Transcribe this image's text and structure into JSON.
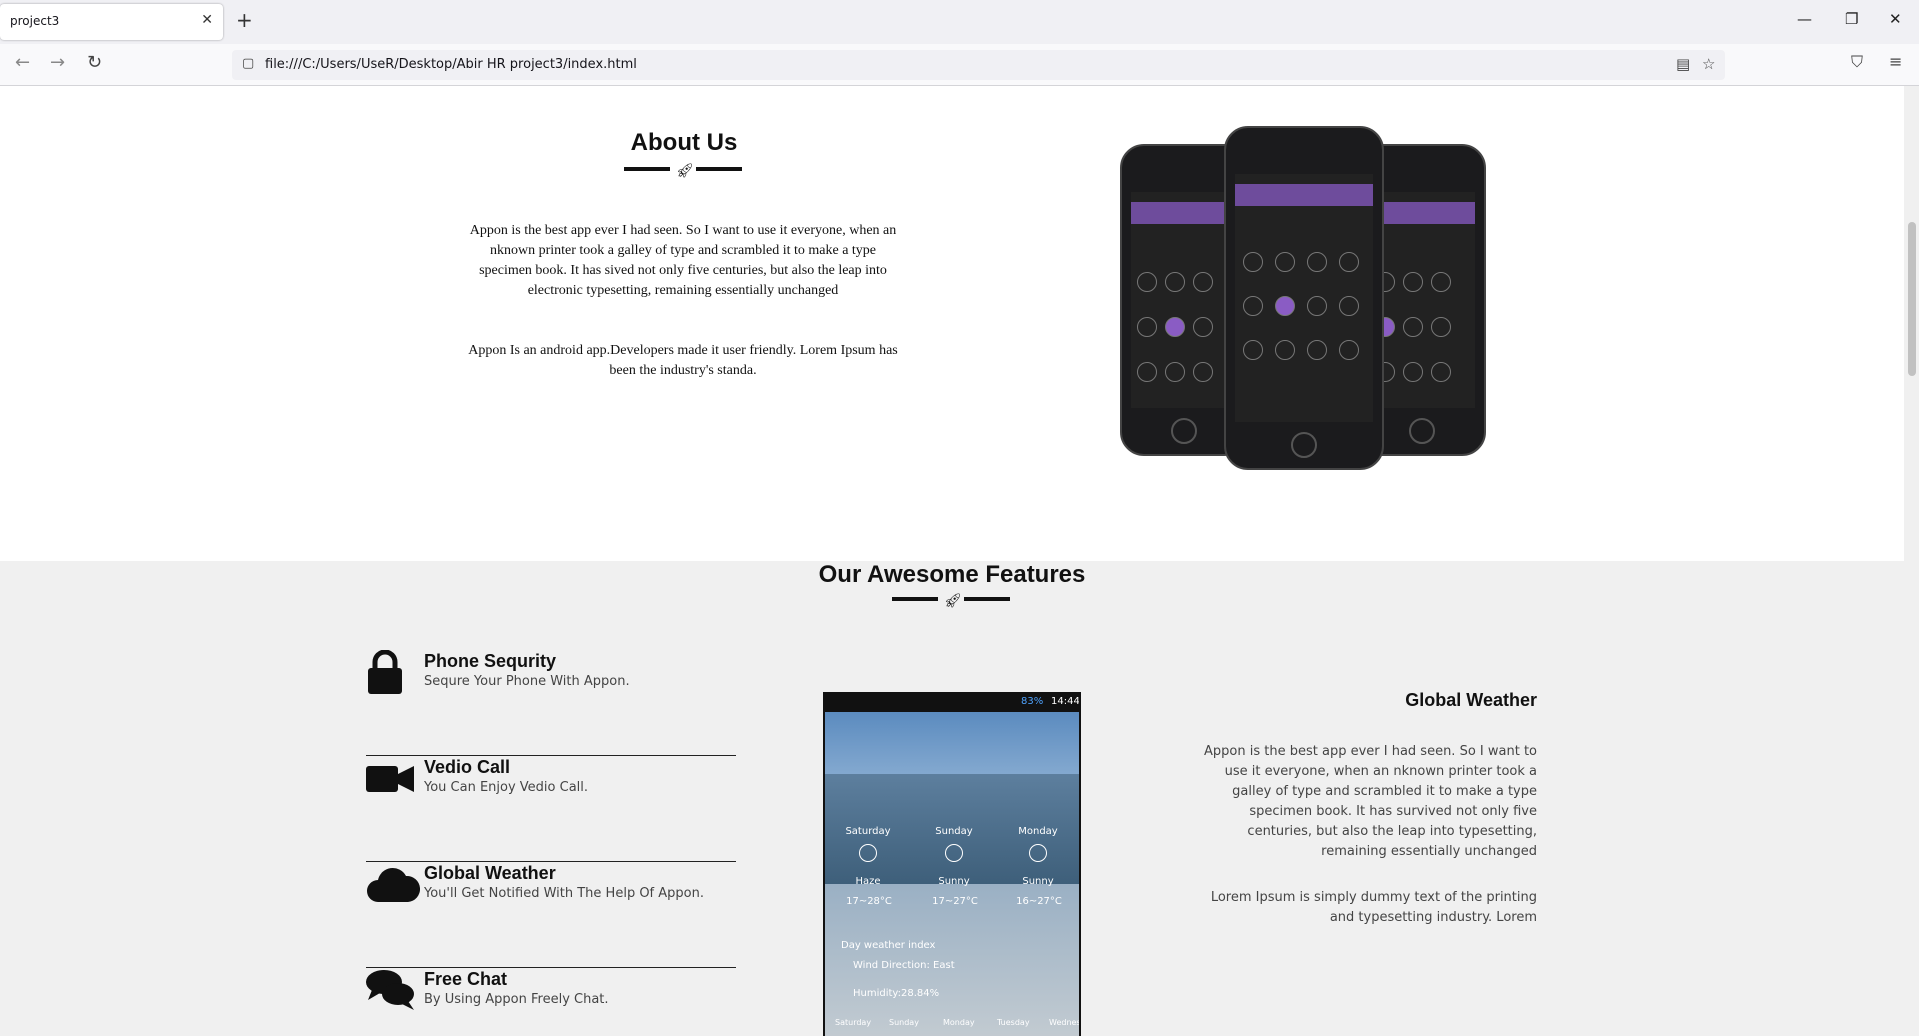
{
  "browser": {
    "tab_title": "project3",
    "url": "file:///C:/Users/UseR/Desktop/Abir HR project3/index.html"
  },
  "about": {
    "title": "About Us",
    "paragraph1": "Appon is the best app ever I had seen. So I want to use it everyone, when an nknown printer took a galley of type and scrambled it to make a type specimen book. It has sived not only five centuries, but also the leap into electronic typesetting, remaining essentially unchanged",
    "paragraph2": "Appon Is an android app.Developers made it user friendly. Lorem Ipsum has been the industry's standa."
  },
  "features": {
    "title": "Our Awesome Features",
    "items": [
      {
        "title": "Phone Sequrity",
        "subtitle": "Sequre Your Phone With Appon.",
        "icon": "lock-icon"
      },
      {
        "title": "Vedio Call",
        "subtitle": "You Can Enjoy Vedio Call.",
        "icon": "video-camera-icon"
      },
      {
        "title": "Global Weather",
        "subtitle": "You'll Get Notified With The Help Of Appon.",
        "icon": "cloud-icon"
      },
      {
        "title": "Free Chat",
        "subtitle": "By Using Appon Freely Chat.",
        "icon": "chat-bubbles-icon"
      }
    ],
    "detail_title": "Global Weather",
    "detail_paragraph1": "Appon is the best app ever I had seen. So I want to use it everyone, when an nknown printer took a galley of type and scrambled it to make a type specimen book. It has survived not only five centuries, but also the leap into typesetting, remaining essentially unchanged",
    "detail_paragraph2": "Lorem Ipsum is simply dummy text of the printing and typesetting industry. Lorem"
  },
  "weather_mock": {
    "battery": "83%",
    "time": "14:44",
    "days": [
      "Saturday",
      "Sunday",
      "Monday"
    ],
    "conditions": [
      "Haze",
      "Sunny",
      "Sunny"
    ],
    "temps": [
      "17~28°C",
      "17~27°C",
      "16~27°C"
    ],
    "index_title": "Day weather index",
    "wind": "Wind Direction: East",
    "humidity": "Humidity:28.84%",
    "bottom_days": [
      "Saturday",
      "Sunday",
      "Monday",
      "Tuesday",
      "Wednes"
    ]
  }
}
